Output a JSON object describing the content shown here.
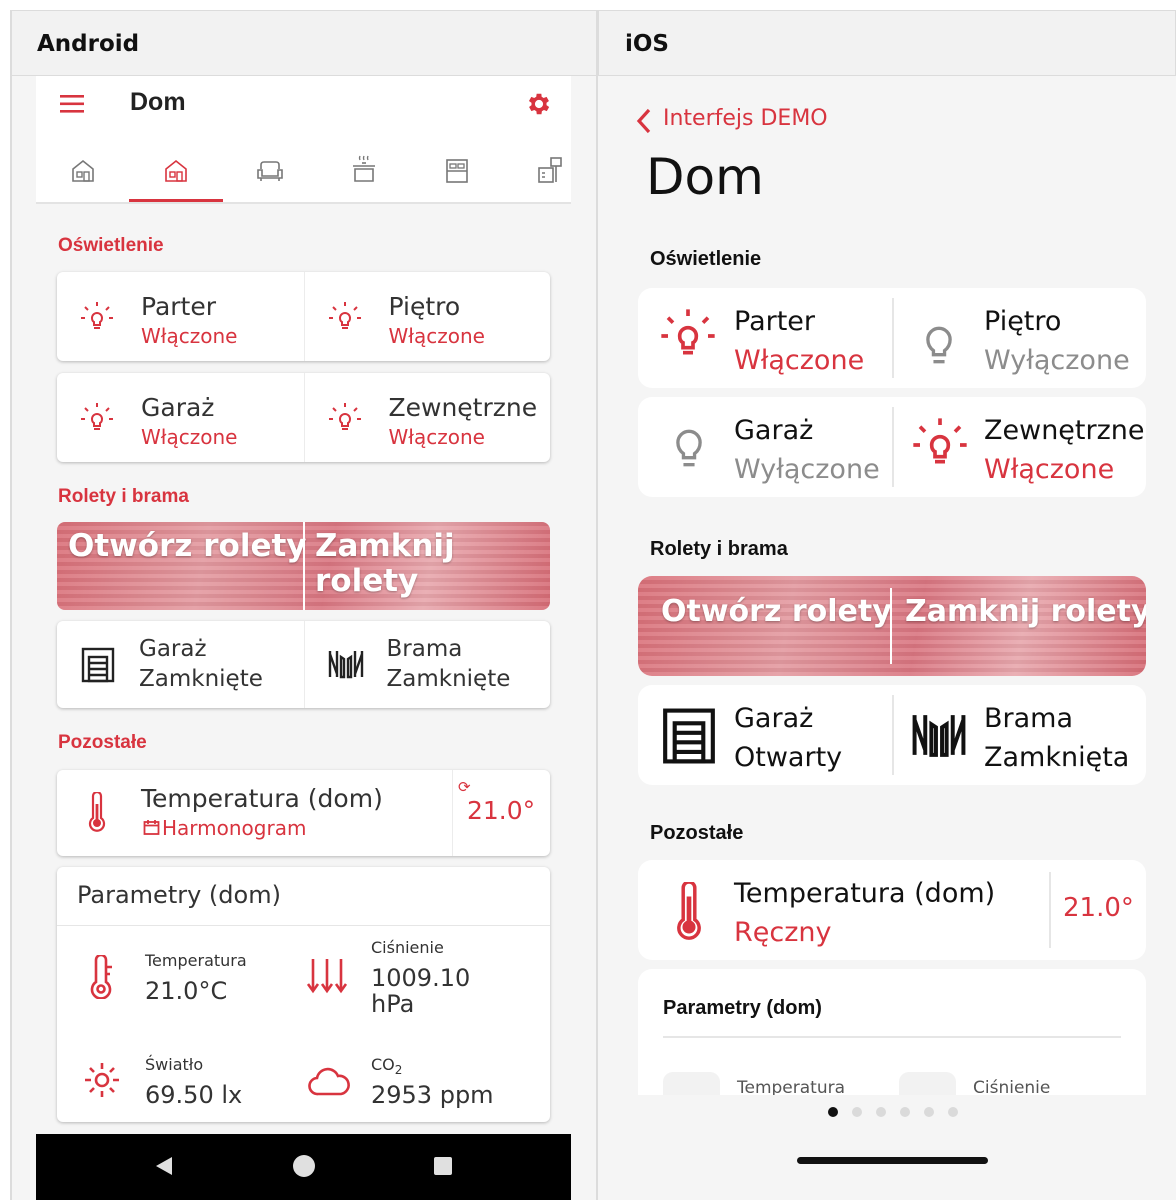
{
  "columns": {
    "android": "Android",
    "ios": "iOS"
  },
  "colors": {
    "accent": "#d8343f",
    "background": "#f5f5f5",
    "card": "#ffffff",
    "off": "#8c8c8c"
  },
  "android": {
    "appbar": {
      "title": "Dom",
      "menu_icon": "hamburger-icon",
      "settings_icon": "gear-icon"
    },
    "tabs": [
      {
        "icon": "house-icon",
        "active": false
      },
      {
        "icon": "house-icon",
        "active": true
      },
      {
        "icon": "sofa-icon",
        "active": false
      },
      {
        "icon": "cooking-pot-icon",
        "active": false
      },
      {
        "icon": "bed-icon",
        "active": false
      },
      {
        "icon": "office-icon",
        "active": false
      }
    ],
    "lighting": {
      "title": "Oświetlenie",
      "items": [
        {
          "name": "Parter",
          "status": "Włączone"
        },
        {
          "name": "Piętro",
          "status": "Włączone"
        },
        {
          "name": "Garaż",
          "status": "Włączone"
        },
        {
          "name": "Zewnętrzne",
          "status": "Włączone"
        }
      ]
    },
    "blinds": {
      "title": "Rolety i brama",
      "open_label": "Otwórz rolety",
      "close_label_1": "Zamknij",
      "close_label_2": "rolety",
      "garage": {
        "name": "Garaż",
        "status": "Zamknięte"
      },
      "gate": {
        "name": "Brama",
        "status": "Zamknięte"
      }
    },
    "other": {
      "title": "Pozostałe",
      "temperature": {
        "name": "Temperatura (dom)",
        "mode": "Harmonogram",
        "value": "21.0°"
      },
      "params": {
        "title": "Parametry (dom)",
        "temp_label": "Temperatura",
        "temp_value": "21.0°C",
        "pressure_label": "Ciśnienie",
        "pressure_value": "1009.10",
        "pressure_unit": "hPa",
        "light_label": "Światło",
        "light_value": "69.50 lx",
        "co2_label": "CO",
        "co2_sub": "2",
        "co2_value": "2953 ppm"
      }
    }
  },
  "ios": {
    "back_label": "Interfejs DEMO",
    "title": "Dom",
    "lighting": {
      "title": "Oświetlenie",
      "items": [
        {
          "name": "Parter",
          "status": "Włączone",
          "on": true
        },
        {
          "name": "Piętro",
          "status": "Wyłączone",
          "on": false
        },
        {
          "name": "Garaż",
          "status": "Wyłączone",
          "on": false
        },
        {
          "name": "Zewnętrzne",
          "status": "Włączone",
          "on": true
        }
      ]
    },
    "blinds": {
      "title": "Rolety i brama",
      "open_label": "Otwórz rolety",
      "close_label": "Zamknij rolety",
      "garage": {
        "name": "Garaż",
        "status": "Otwarty"
      },
      "gate": {
        "name": "Brama",
        "status": "Zamknięta"
      }
    },
    "other": {
      "title": "Pozostałe",
      "temperature": {
        "name": "Temperatura (dom)",
        "mode": "Ręczny",
        "value": "21.0°"
      },
      "params": {
        "title": "Parametry (dom)",
        "temp_label": "Temperatura",
        "pressure_label": "Ciśnienie"
      }
    },
    "page_dots": {
      "count": 6,
      "active": 1
    }
  }
}
